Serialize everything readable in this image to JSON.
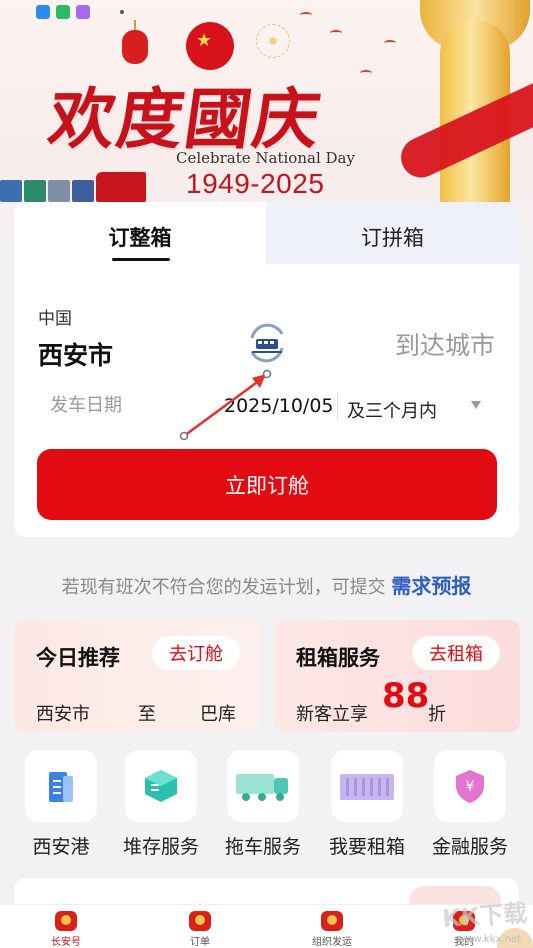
{
  "banner": {
    "title": "欢度國庆",
    "subtitle": "Celebrate National Day",
    "years": "1949-2025"
  },
  "booking": {
    "tabs": [
      {
        "label": "订整箱",
        "active": true
      },
      {
        "label": "订拼箱",
        "active": false
      }
    ],
    "origin_country": "中国",
    "origin_city": "西安市",
    "destination_placeholder": "到达城市",
    "date_placeholder": "发车日期",
    "date_value": "2025/10/05",
    "date_range": "及三个月内",
    "submit_label": "立即订舱"
  },
  "hint": {
    "text": "若现有班次不符合您的发运计划，可提交",
    "link": "需求预报"
  },
  "promos": {
    "recommend": {
      "title": "今日推荐",
      "button": "去订舱",
      "from": "西安市",
      "to_word": "至",
      "dest": "巴库"
    },
    "rental": {
      "title": "租箱服务",
      "button": "去租箱",
      "discount_prefix": "新客立享",
      "discount_value": "88",
      "discount_suffix": "折"
    }
  },
  "services": [
    {
      "label": "西安港",
      "icon": "building-icon"
    },
    {
      "label": "堆存服务",
      "icon": "storage-cube-icon"
    },
    {
      "label": "拖车服务",
      "icon": "truck-icon"
    },
    {
      "label": "我要租箱",
      "icon": "container-icon"
    },
    {
      "label": "金融服务",
      "icon": "finance-shield-icon"
    }
  ],
  "nav": [
    {
      "label": "长安号",
      "active": true
    },
    {
      "label": "订单",
      "active": false
    },
    {
      "label": "组织发运",
      "active": false
    },
    {
      "label": "我的",
      "active": false
    }
  ],
  "watermark": {
    "text": "KK下载",
    "url": "www.kkx.net"
  },
  "colors": {
    "primary_red": "#e30b12",
    "link_blue": "#2f5fc4",
    "tab_inactive_bg": "#eef1f8"
  }
}
